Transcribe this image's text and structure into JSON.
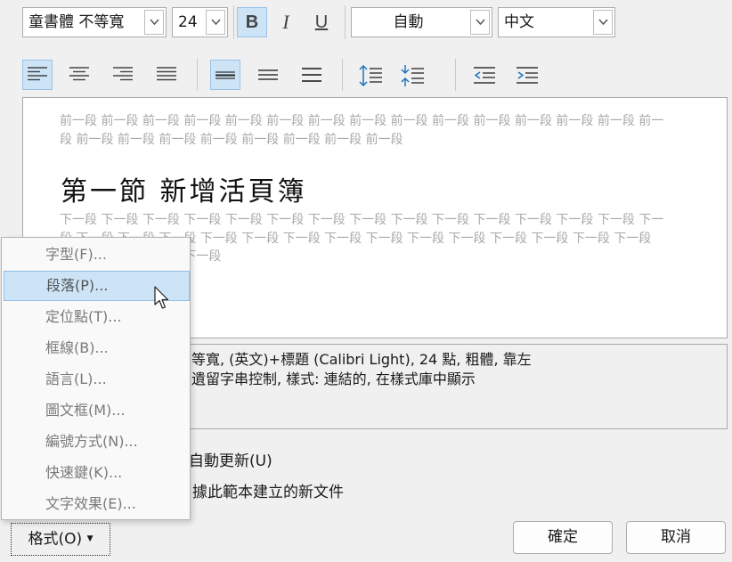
{
  "toolbar": {
    "font_name": "童書體 不等寬",
    "font_size": "24",
    "bold": "B",
    "italic": "I",
    "underline": "U",
    "color": "自動",
    "language": "中文"
  },
  "preview": {
    "prev_text": "前一段 前一段 前一段 前一段 前一段 前一段 前一段 前一段 前一段 前一段 前一段 前一段 前一段 前一段 前一段 前一段 前一段 前一段 前一段 前一段 前一段 前一段 前一段",
    "heading": "第一節 新增活頁簿",
    "next_text": "下一段 下一段 下一段 下一段 下一段 下一段 下一段 下一段 下一段 下一段 下一段 下一段 下一段 下一段 下一段 下一段 下一段 下一段 下一段 下一段 下一段 下一段 下一段 下一段 下一段 下一段 下一段 下一段 下一段 下一段 下一段 下一段 下一段"
  },
  "description": {
    "line1": "等寬, (英文)+標題 (Calibri Light), 24 點, 粗體, 靠左",
    "line2": "遺留字串控制, 樣式: 連結的, 在樣式庫中顯示"
  },
  "options": {
    "auto_update": "自動更新(U)",
    "new_docs": "據此範本建立的新文件"
  },
  "menu": {
    "items": [
      {
        "label": "字型(F)..."
      },
      {
        "label": "段落(P)..."
      },
      {
        "label": "定位點(T)..."
      },
      {
        "label": "框線(B)..."
      },
      {
        "label": "語言(L)..."
      },
      {
        "label": "圖文框(M)..."
      },
      {
        "label": "編號方式(N)..."
      },
      {
        "label": "快速鍵(K)..."
      },
      {
        "label": "文字效果(E)..."
      }
    ]
  },
  "buttons": {
    "format": "格式(O)",
    "ok": "確定",
    "cancel": "取消"
  }
}
